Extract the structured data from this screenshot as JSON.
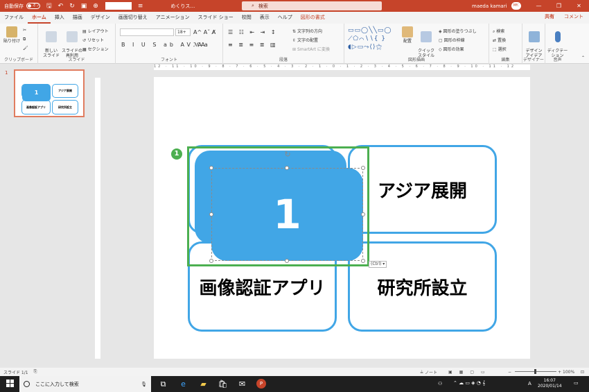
{
  "titlebar": {
    "autosave_label": "自動保存",
    "autosave_state": "オフ",
    "doc_title": "めくりス…",
    "search_placeholder": "検索",
    "user_name": "maeda kamari",
    "user_initials": "MK"
  },
  "menu": {
    "tabs": [
      "ファイル",
      "ホーム",
      "挿入",
      "描画",
      "デザイン",
      "画面切り替え",
      "アニメーション",
      "スライド ショー",
      "校閲",
      "表示",
      "ヘルプ",
      "図形の書式"
    ],
    "active_tab": "ホーム",
    "share_label": "共有",
    "comment_label": "コメント"
  },
  "ribbon": {
    "clipboard": {
      "paste": "貼り付け",
      "label": "クリップボード"
    },
    "slides": {
      "new_slide": "新しい\nスライド",
      "reuse": "スライドの\n再利用",
      "layout": "レイアウト",
      "reset": "リセット",
      "section": "セクション",
      "label": "スライド"
    },
    "font": {
      "size": "18+",
      "label": "フォント"
    },
    "paragraph": {
      "text_direction": "文字列の方向",
      "align_text": "文字の配置",
      "smartart": "SmartArt に変換",
      "label": "段落"
    },
    "drawing": {
      "arrange": "配置",
      "quick_styles": "クイック\nスタイル",
      "fill": "図形の塗りつぶし",
      "outline": "図形の枠線",
      "effects": "図形の効果",
      "label": "図形描画"
    },
    "editing": {
      "find": "検索",
      "replace": "置換",
      "select": "選択",
      "label": "編集"
    },
    "designer": {
      "design_ideas": "デザイン\nアイデア",
      "label": "デザイナー"
    },
    "voice": {
      "dictate": "ディクテー\nション",
      "label": "音声"
    }
  },
  "thumbnails": {
    "slide_number": "1",
    "boxes": [
      "1",
      "アジア展開",
      "画像認証アプリ",
      "研究所設立"
    ]
  },
  "slide": {
    "box_top_right": "アジア展開",
    "box_bottom_left": "画像認証アプリ",
    "box_bottom_right": "研究所設立",
    "selected_shape_text": "1",
    "annotation_badge": "1",
    "ctrl_tag": "(Ctrl) ▾"
  },
  "ruler": {
    "marks": "12 · 11 · 10 · 9 · 8 · 7 · 6 · 5 · 4 · 3 · 2 · 1 · 0 · 1 · 2 · 3 · 4 · 5 · 6 · 7 · 8 · 9 · 10 · 11 · 12"
  },
  "status": {
    "slide_count": "スライド 1/1",
    "notes_label": "ノート",
    "zoom": "100%"
  },
  "taskbar": {
    "search_placeholder": "ここに入力して検索",
    "time": "16:07",
    "date": "2020/01/14",
    "ime": "A"
  },
  "colors": {
    "accent": "#c6442a",
    "shape_blue": "#41a6e6",
    "annotation_green": "#4caf50"
  }
}
